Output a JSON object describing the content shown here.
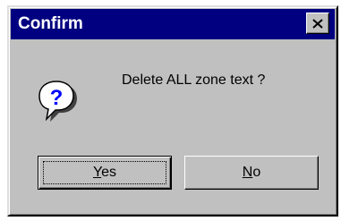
{
  "window": {
    "title": "Confirm",
    "close_icon": "close-x-icon",
    "colors": {
      "titlebar": "#000080",
      "face": "#c0c0c0",
      "title_text": "#ffffff"
    }
  },
  "message": {
    "icon": "question-mark-icon",
    "text": "Delete ALL zone text ?"
  },
  "buttons": {
    "yes": {
      "accel": "Y",
      "rest": "es",
      "default": true
    },
    "no": {
      "accel": "N",
      "rest": "o",
      "default": false
    }
  }
}
